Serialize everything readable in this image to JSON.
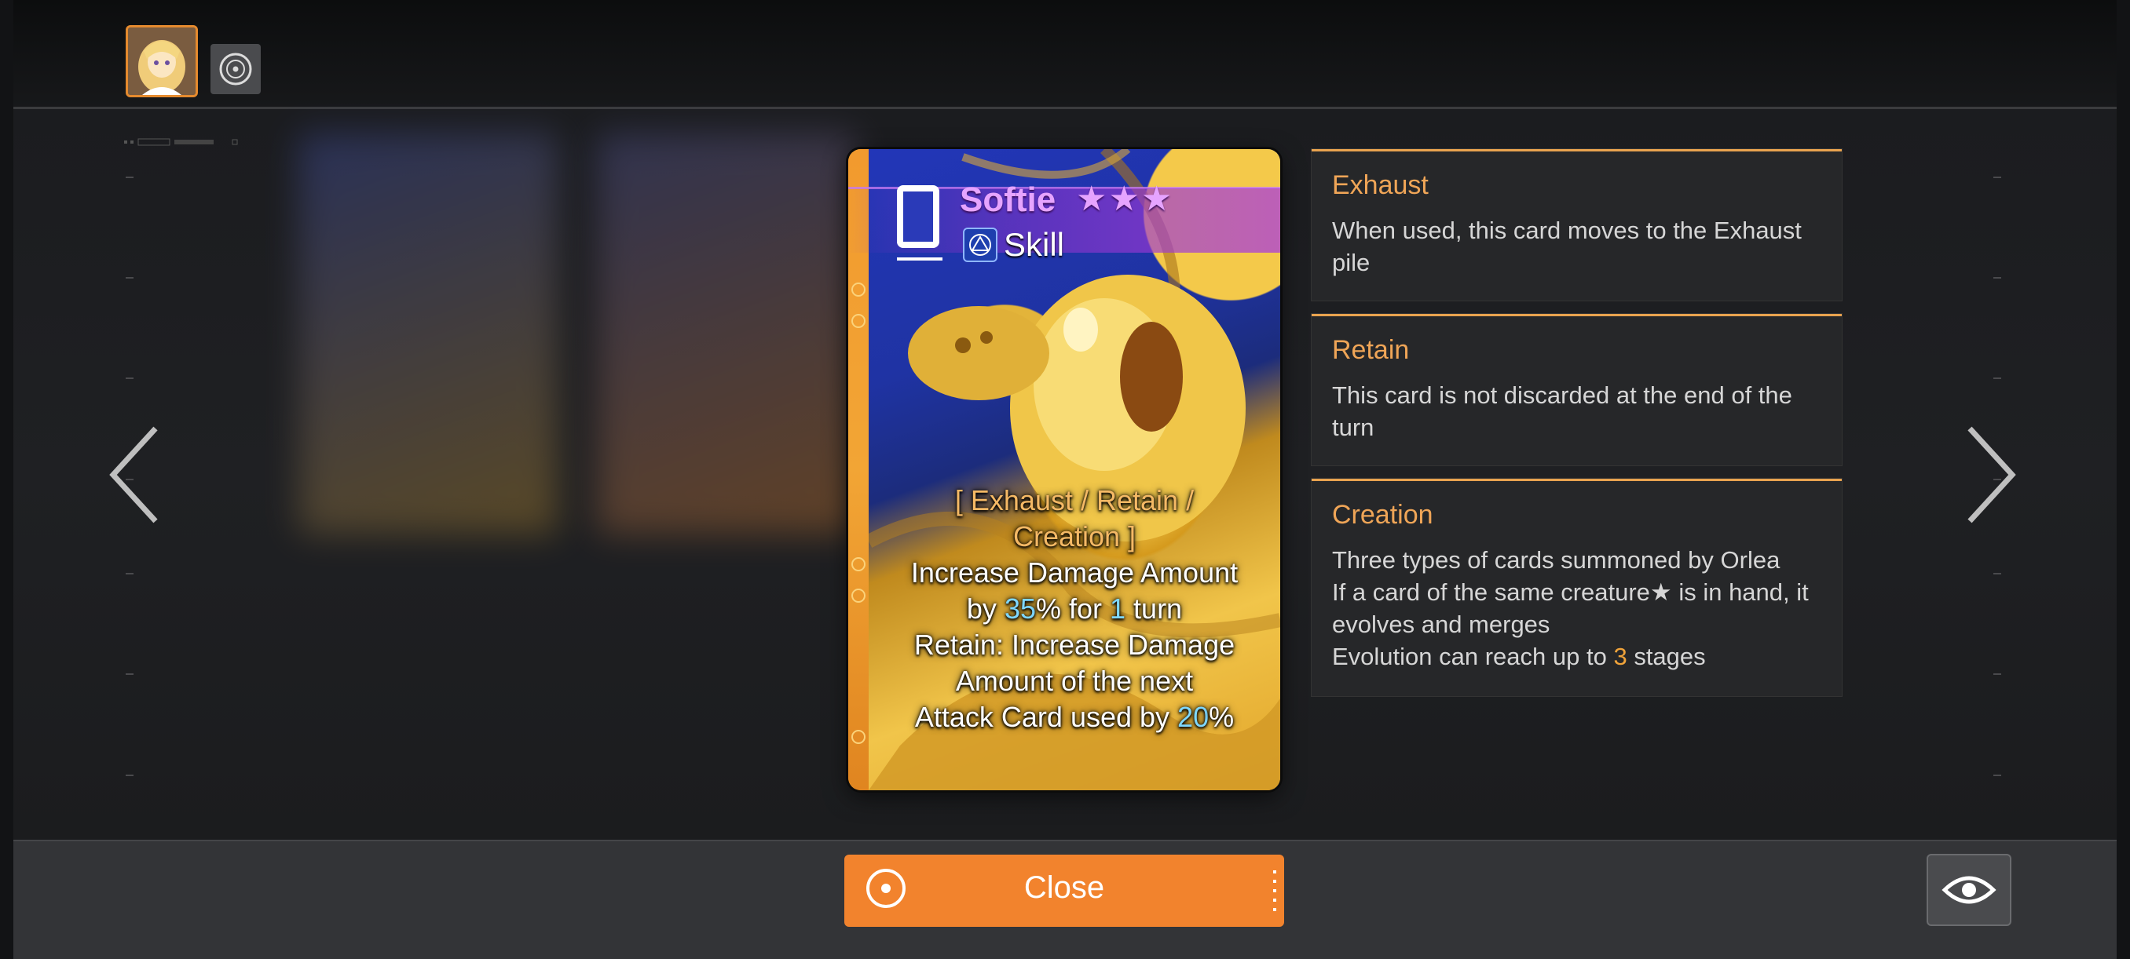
{
  "header": {
    "tabs": [
      {
        "name": "character-portrait",
        "icon": "character-portrait-icon",
        "selected": true
      },
      {
        "name": "ring-emblem",
        "icon": "ring-emblem-icon",
        "selected": false
      }
    ]
  },
  "card": {
    "cost": "0",
    "name": "Softie",
    "stars": "★★★",
    "type_icon": "skill-type-icon",
    "type": "Skill",
    "keywords_open": "[ ",
    "kw1": "Exhaust",
    "sep1": " / ",
    "kw2": "Retain",
    "sep2": " / ",
    "kw3": "Creation",
    "keywords_close": " ]",
    "line1a": "Increase Damage Amount",
    "line1b_pre": "by ",
    "line1b_num": "35",
    "line1b_mid": "% for ",
    "line1b_num2": "1",
    "line1b_post": " turn",
    "line2a": "Retain: Increase Damage",
    "line2b": "Amount of the next",
    "line2c_pre": "Attack Card used by ",
    "line2c_num": "20",
    "line2c_post": "%"
  },
  "tooltips": [
    {
      "title": "Exhaust",
      "body": "When used, this card moves to the Exhaust pile"
    },
    {
      "title": "Retain",
      "body": "This card is not discarded at the end of the turn"
    },
    {
      "title": "Creation",
      "body1": "Three types of cards summoned by Orlea",
      "body2": "If a card of the same creature★ is in hand, it evolves and merges",
      "body3_pre": "Evolution can reach up to ",
      "body3_num": "3",
      "body3_post": " stages"
    }
  ],
  "nav": {
    "prev_icon": "chevron-left-icon",
    "next_icon": "chevron-right-icon"
  },
  "footer": {
    "close_label": "Close",
    "view_icon": "eye-icon"
  },
  "colors": {
    "accent": "#f2832d",
    "keyword": "#efa557",
    "number": "#7fd8ff",
    "name": "#e6a4ff"
  }
}
